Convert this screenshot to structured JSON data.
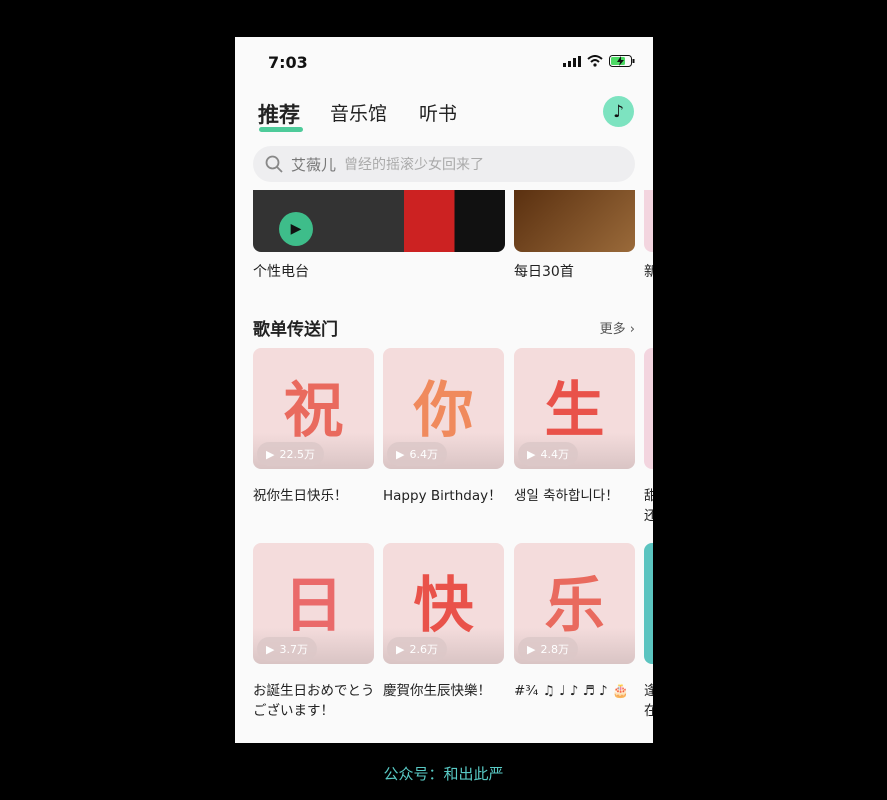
{
  "status": {
    "time": "7:03"
  },
  "tabs": [
    {
      "label": "推荐"
    },
    {
      "label": "音乐馆"
    },
    {
      "label": "听书"
    }
  ],
  "search": {
    "hint_artist": "艾薇儿",
    "hint_text": "曾经的摇滚少女回来了"
  },
  "banners": [
    {
      "label": "个性电台"
    },
    {
      "label": "每日30首"
    },
    {
      "label": "新"
    }
  ],
  "section": {
    "title": "歌单传送门",
    "more": "更多"
  },
  "playlists": [
    {
      "glyph": "祝",
      "count": "22.5万",
      "title": "祝你生日快乐！",
      "color": "#e96a5e"
    },
    {
      "glyph": "你",
      "count": "6.4万",
      "title": "Happy Birthday！",
      "color": "#f08a5d"
    },
    {
      "glyph": "生",
      "count": "4.4万",
      "title": "생일 축하합니다！",
      "color": "#e9524a"
    },
    {
      "glyph": "",
      "count": "",
      "title": "甜\n还",
      "color": "#f3d5df"
    },
    {
      "glyph": "日",
      "count": "3.7万",
      "title": "お誕生日おめでとうございます！",
      "color": "#ea6a6a"
    },
    {
      "glyph": "快",
      "count": "2.6万",
      "title": "慶賀你生辰快樂！",
      "color": "#e9524a"
    },
    {
      "glyph": "乐",
      "count": "2.8万",
      "title": "#¾ ♫ ♩ ♪ ♬ ♪ 🎂",
      "color": "#e96a5e"
    },
    {
      "glyph": "",
      "count": "",
      "title": "逢\n在",
      "color": "#5bc4c0"
    }
  ],
  "watermark": "公众号：和出此严"
}
